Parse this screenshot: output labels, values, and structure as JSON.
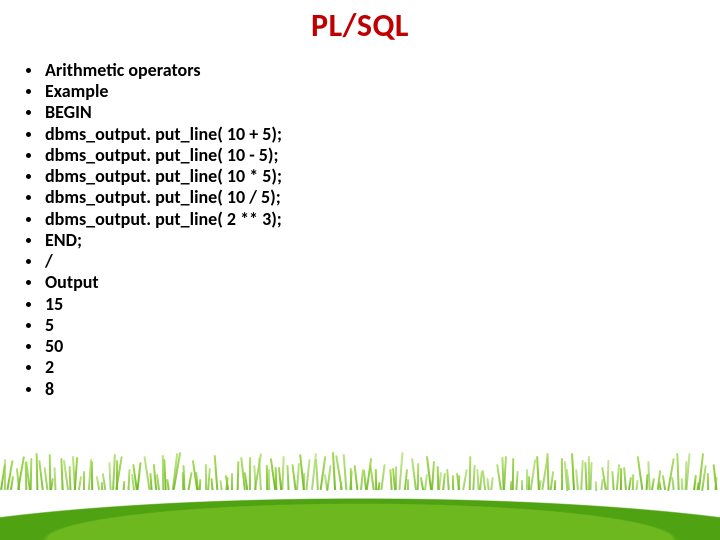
{
  "title": "PL/SQL",
  "bullets": [
    "Arithmetic operators",
    "Example",
    "BEGIN",
    "dbms_output. put_line( 10 + 5);",
    "dbms_output. put_line( 10 - 5);",
    "dbms_output. put_line( 10 * 5);",
    "dbms_output. put_line( 10 / 5);",
    "dbms_output. put_line( 2 ** 3);",
    "END;",
    "/",
    "Output",
    "15",
    "5",
    "50",
    "2",
    "8"
  ]
}
